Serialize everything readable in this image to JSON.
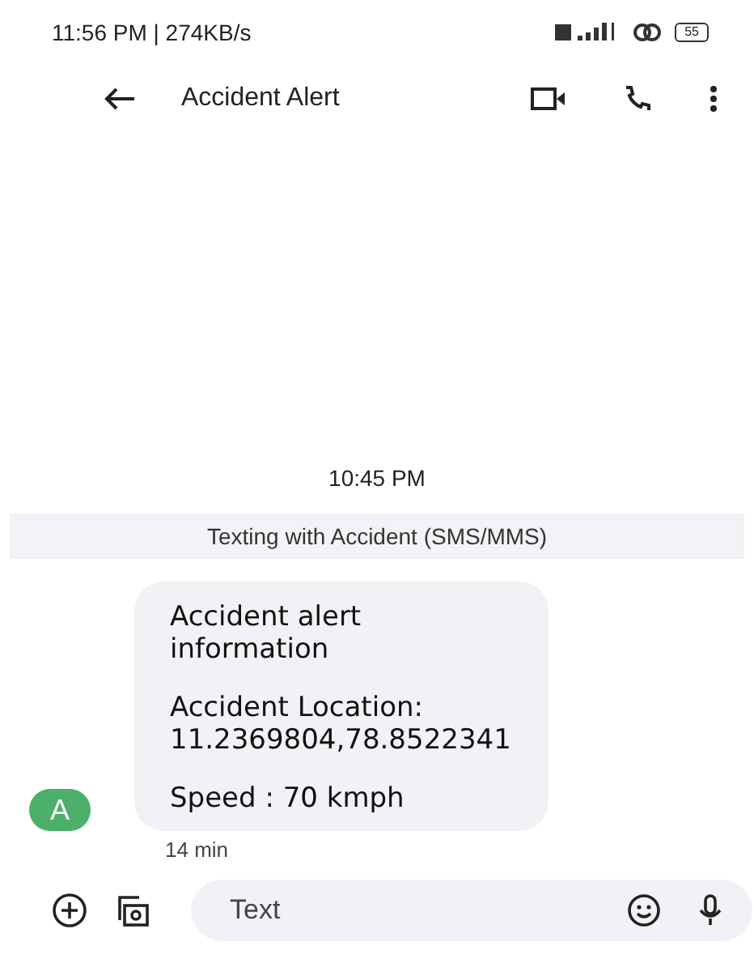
{
  "status_bar": {
    "time": "11:56 PM | 274KB/s",
    "battery": "55"
  },
  "header": {
    "title": "Accident Alert"
  },
  "thread": {
    "timestamp": "10:45 PM",
    "banner": "Texting with Accident (SMS/MMS)",
    "message": {
      "avatar": "A",
      "color": "#4caf6a",
      "paragraphs": [
        "Accident alert information",
        "Accident Location: 11.2369804,78.8522341",
        "Speed : 70 kmph"
      ],
      "age": "14 min"
    }
  },
  "compose": {
    "placeholder": "Text"
  }
}
